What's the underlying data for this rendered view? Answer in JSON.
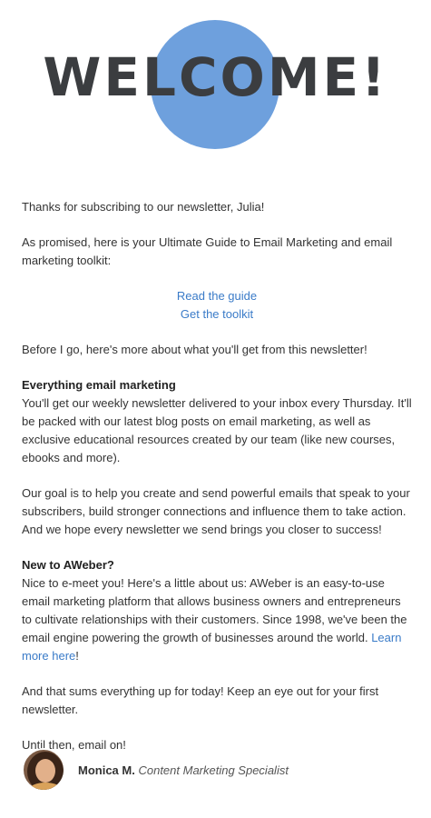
{
  "hero": {
    "title": "WELCOME!"
  },
  "greeting": "Thanks for subscribing to our newsletter, Julia!",
  "promise": "As promised, here is your Ultimate Guide to Email Marketing and email marketing toolkit:",
  "links": {
    "guide": "Read the guide",
    "toolkit": "Get the toolkit"
  },
  "before_text": "Before I go, here's more about what you'll get from this newsletter!",
  "section1": {
    "heading": "Everything email marketing",
    "body": "You'll get our weekly newsletter delivered to your inbox every Thursday. It'll be packed with our latest blog posts on email marketing, as well as exclusive educational resources created by our team (like new courses, ebooks and more)."
  },
  "goal_text": "Our goal is to help you create and send powerful emails that speak to your subscribers, build stronger connections and influence them to take action. And we hope every newsletter we send brings you closer to success!",
  "section2": {
    "heading": "New to AWeber?",
    "body": "Nice to e-meet you! Here's a little about us: AWeber is an easy-to-use email marketing platform that allows business owners and entrepreneurs to cultivate relationships with their customers. Since 1998, we've been the email engine powering the growth of businesses around the world. ",
    "link": "Learn more here",
    "after_link": "!"
  },
  "closing": "And that sums everything up for today! Keep an eye out for your first newsletter.",
  "signoff": "Until then, email on!",
  "signature": {
    "name": "Monica M.",
    "role": "Content Marketing Specialist"
  },
  "colors": {
    "circle": "#6ea0dd",
    "link": "#3a7bc8",
    "title": "#3b3d40"
  }
}
